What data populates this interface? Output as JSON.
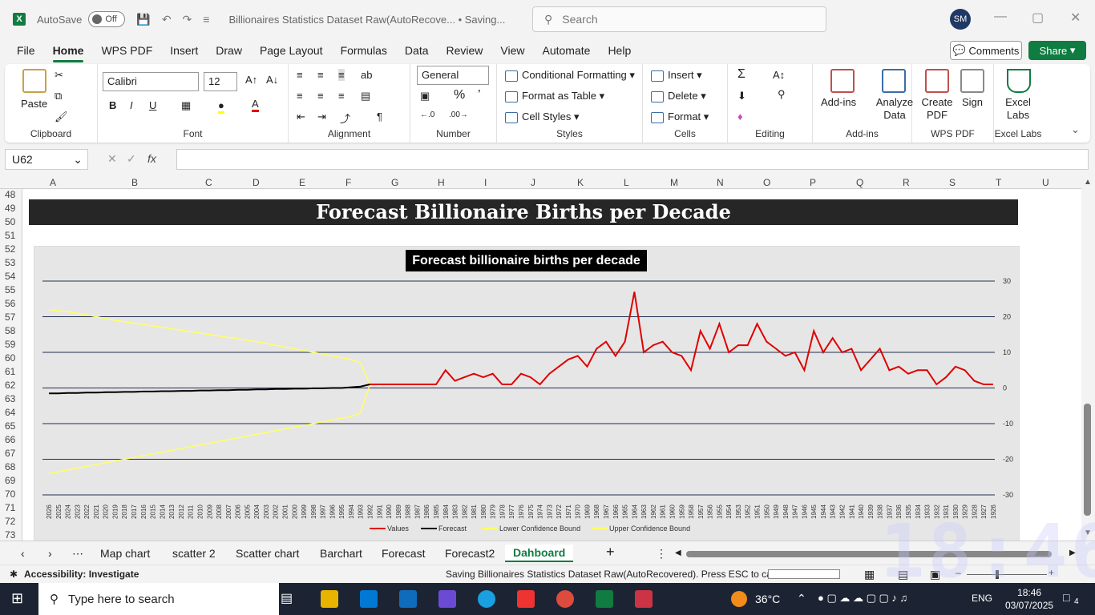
{
  "titlebar": {
    "autosave_label": "AutoSave",
    "autosave_state": "Off",
    "doc_title": "Billionaires Statistics Dataset Raw(AutoRecove... • Saving...",
    "search_placeholder": "Search",
    "avatar_initials": "SM"
  },
  "menu": {
    "items": [
      "File",
      "Home",
      "WPS PDF",
      "Insert",
      "Draw",
      "Page Layout",
      "Formulas",
      "Data",
      "Review",
      "View",
      "Automate",
      "Help"
    ],
    "active": "Home",
    "comments": "Comments",
    "share": "Share"
  },
  "ribbon": {
    "clipboard": {
      "paste": "Paste",
      "label": "Clipboard"
    },
    "font": {
      "name": "Calibri",
      "size": "12",
      "label": "Font",
      "bold": "B",
      "italic": "I",
      "underline": "U"
    },
    "alignment": {
      "label": "Alignment"
    },
    "number": {
      "format": "General",
      "label": "Number"
    },
    "styles": {
      "conditional": "Conditional Formatting",
      "table": "Format as Table",
      "cell": "Cell Styles",
      "label": "Styles"
    },
    "cells": {
      "insert": "Insert",
      "delete": "Delete",
      "format": "Format",
      "label": "Cells"
    },
    "editing": {
      "label": "Editing"
    },
    "addins": {
      "addins": "Add-ins",
      "analyze": "Analyze Data",
      "label": "Add-ins"
    },
    "wps": {
      "create": "Create PDF",
      "sign": "Sign",
      "label": "WPS PDF"
    },
    "labs": {
      "excel_labs": "Excel Labs",
      "label": "Excel Labs"
    }
  },
  "formula_bar": {
    "cell_ref": "U62",
    "fx": "fx",
    "value": ""
  },
  "columns": [
    "A",
    "B",
    "C",
    "D",
    "E",
    "F",
    "G",
    "H",
    "I",
    "J",
    "K",
    "L",
    "M",
    "N",
    "O",
    "P",
    "Q",
    "R",
    "S",
    "T",
    "U"
  ],
  "rows": [
    "48",
    "49",
    "50",
    "51",
    "52",
    "53",
    "54",
    "55",
    "56",
    "57",
    "58",
    "59",
    "60",
    "61",
    "62",
    "63",
    "64",
    "65",
    "66",
    "67",
    "68",
    "69",
    "70",
    "71",
    "72",
    "73"
  ],
  "banner_title": "Forecast  Billionaire Births per Decade",
  "chart_data": {
    "type": "line",
    "title": "Forecast billionaire births per decade",
    "ylim": [
      -30,
      30
    ],
    "yticks": [
      30,
      20,
      10,
      0,
      -10,
      -20,
      -30
    ],
    "grid": true,
    "legend_position": "bottom",
    "series": [
      {
        "name": "Values",
        "color": "#e00000"
      },
      {
        "name": "Forecast",
        "color": "#000000"
      },
      {
        "name": "Lower Confidence Bound",
        "color": "#ffff66"
      },
      {
        "name": "Upper Confidence Bound",
        "color": "#ffff66"
      }
    ],
    "x": [
      "2026",
      "2025",
      "2024",
      "2023",
      "2022",
      "2021",
      "2020",
      "2019",
      "2018",
      "2017",
      "2016",
      "2015",
      "2014",
      "2013",
      "2012",
      "2011",
      "2010",
      "2009",
      "2008",
      "2007",
      "2006",
      "2005",
      "2004",
      "2003",
      "2002",
      "2001",
      "2000",
      "1999",
      "1998",
      "1997",
      "1996",
      "1995",
      "1994",
      "1993",
      "1992",
      "1991",
      "1990",
      "1989",
      "1988",
      "1987",
      "1986",
      "1985",
      "1984",
      "1983",
      "1982",
      "1981",
      "1980",
      "1979",
      "1978",
      "1977",
      "1976",
      "1975",
      "1974",
      "1973",
      "1972",
      "1971",
      "1970",
      "1969",
      "1968",
      "1967",
      "1966",
      "1965",
      "1964",
      "1963",
      "1962",
      "1961",
      "1960",
      "1959",
      "1958",
      "1957",
      "1956",
      "1955",
      "1954",
      "1953",
      "1952",
      "1951",
      "1950",
      "1949",
      "1948",
      "1947",
      "1946",
      "1945",
      "1944",
      "1943",
      "1942",
      "1941",
      "1940",
      "1939",
      "1938",
      "1937",
      "1936",
      "1935",
      "1934",
      "1933",
      "1932",
      "1931",
      "1930",
      "1929",
      "1928",
      "1927",
      "1926"
    ],
    "values": [
      null,
      null,
      null,
      null,
      null,
      null,
      null,
      null,
      null,
      null,
      null,
      null,
      null,
      null,
      null,
      null,
      null,
      null,
      null,
      null,
      null,
      null,
      null,
      null,
      null,
      null,
      null,
      null,
      null,
      null,
      null,
      null,
      null,
      null,
      1,
      1,
      1,
      1,
      1,
      1,
      1,
      1,
      5,
      2,
      3,
      4,
      3,
      4,
      1,
      1,
      4,
      3,
      1,
      4,
      6,
      8,
      9,
      6,
      11,
      13,
      9,
      13,
      27,
      10,
      12,
      13,
      10,
      9,
      5,
      16,
      11,
      18,
      10,
      12,
      12,
      18,
      13,
      11,
      9,
      10,
      5,
      16,
      10,
      14,
      10,
      11,
      5,
      8,
      11,
      5,
      6,
      4,
      5,
      5,
      1,
      3,
      6,
      5,
      2,
      1,
      1
    ],
    "forecast": [
      -1.5,
      -1.5,
      -1.4,
      -1.4,
      -1.3,
      -1.3,
      -1.2,
      -1.2,
      -1.1,
      -1.1,
      -1.0,
      -1.0,
      -0.9,
      -0.9,
      -0.8,
      -0.8,
      -0.7,
      -0.7,
      -0.6,
      -0.6,
      -0.5,
      -0.5,
      -0.4,
      -0.4,
      -0.3,
      -0.3,
      -0.2,
      -0.2,
      -0.1,
      -0.1,
      0.0,
      0.0,
      0.2,
      0.4,
      1,
      null,
      null,
      null,
      null,
      null,
      null,
      null,
      null,
      null,
      null,
      null,
      null,
      null,
      null,
      null,
      null,
      null,
      null,
      null,
      null,
      null,
      null,
      null,
      null,
      null,
      null,
      null,
      null,
      null,
      null,
      null,
      null,
      null,
      null,
      null,
      null,
      null,
      null,
      null,
      null,
      null,
      null,
      null,
      null,
      null,
      null,
      null,
      null,
      null,
      null,
      null,
      null,
      null,
      null,
      null,
      null,
      null,
      null,
      null,
      null,
      null,
      null,
      null,
      null,
      null,
      null
    ],
    "lower": [
      -24,
      -23.5,
      -23,
      -22.5,
      -22,
      -21.5,
      -21,
      -20.5,
      -20,
      -19.5,
      -19,
      -18.5,
      -18,
      -17.5,
      -17,
      -16.5,
      -16,
      -15.5,
      -15,
      -14.5,
      -14,
      -13.5,
      -13,
      -12.5,
      -12,
      -11.5,
      -11,
      -10.5,
      -10,
      -9.5,
      -9,
      -8.5,
      -8,
      -7,
      1,
      null,
      null,
      null,
      null,
      null,
      null,
      null,
      null,
      null,
      null,
      null,
      null,
      null,
      null,
      null,
      null,
      null,
      null,
      null,
      null,
      null,
      null,
      null,
      null,
      null,
      null,
      null,
      null,
      null,
      null,
      null,
      null,
      null,
      null,
      null,
      null,
      null,
      null,
      null,
      null,
      null,
      null,
      null,
      null,
      null,
      null,
      null,
      null,
      null,
      null,
      null,
      null,
      null,
      null,
      null,
      null,
      null,
      null,
      null,
      null,
      null,
      null,
      null,
      null,
      null,
      null
    ],
    "upper": [
      22,
      21.7,
      21.4,
      21,
      20.5,
      20,
      19.5,
      19,
      18.6,
      18.2,
      17.8,
      17.4,
      17,
      16.6,
      16.2,
      15.8,
      15.4,
      15,
      14.6,
      14.2,
      13.8,
      13.4,
      13,
      12.5,
      12,
      11.5,
      11,
      10.5,
      10,
      9.5,
      9,
      8.5,
      8,
      7,
      1,
      null,
      null,
      null,
      null,
      null,
      null,
      null,
      null,
      null,
      null,
      null,
      null,
      null,
      null,
      null,
      null,
      null,
      null,
      null,
      null,
      null,
      null,
      null,
      null,
      null,
      null,
      null,
      null,
      null,
      null,
      null,
      null,
      null,
      null,
      null,
      null,
      null,
      null,
      null,
      null,
      null,
      null,
      null,
      null,
      null,
      null,
      null,
      null,
      null,
      null,
      null,
      null,
      null,
      null,
      null,
      null,
      null,
      null,
      null,
      null,
      null,
      null,
      null,
      null,
      null,
      null
    ]
  },
  "sheet_tabs": [
    "Map chart",
    "scatter 2",
    "Scatter chart",
    "Barchart",
    "Forecast",
    "Forecast2",
    "Dahboard"
  ],
  "active_tab": "Dahboard",
  "status": {
    "accessibility": "Accessibility: Investigate",
    "saving": "Saving Billionaires Statistics Dataset Raw(AutoRecovered). Press ESC to cancel."
  },
  "taskbar": {
    "search_placeholder": "Type here to search",
    "temperature": "36°C",
    "language": "ENG",
    "time": "18:46",
    "date": "03/07/2025",
    "notifications": "4"
  },
  "overlay_clock": "18:46"
}
